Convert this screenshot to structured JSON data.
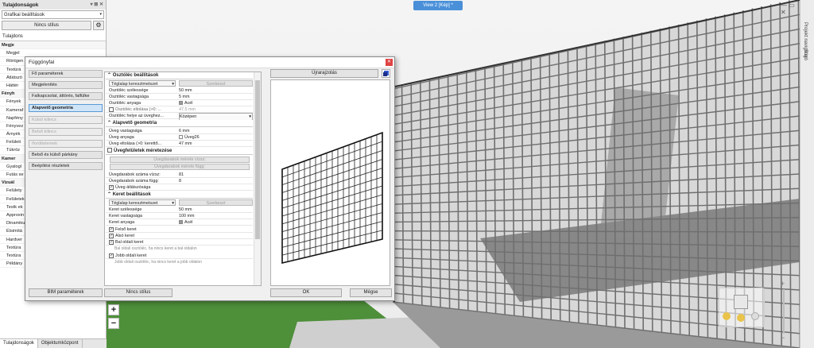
{
  "left_panel": {
    "title": "Tulajdonságok",
    "title_controls": "▾ ⊠ ✕",
    "category_select": "Grafikai beállítások",
    "style_button": "Nincs stílus",
    "tab_header": "Tulajdons",
    "rows": [
      {
        "t": "Megje",
        "sec": true
      },
      {
        "t": "Megjel",
        "sec": false
      },
      {
        "t": "Röntgen",
        "sec": false
      },
      {
        "t": "Textúrá",
        "sec": false
      },
      {
        "t": "Átlátszó",
        "sec": false
      },
      {
        "t": "Háttér",
        "sec": false
      },
      {
        "t": "Fényh",
        "sec": true
      },
      {
        "t": "Fények",
        "sec": false
      },
      {
        "t": "Kameraf",
        "sec": false
      },
      {
        "t": "Napfény",
        "sec": false
      },
      {
        "t": "Fényvez",
        "sec": false
      },
      {
        "t": "Árnyék",
        "sec": false
      },
      {
        "t": "Felületi",
        "sec": false
      },
      {
        "t": "Tükröz",
        "sec": false
      },
      {
        "t": "Kamer",
        "sec": true
      },
      {
        "t": "Gyalogl",
        "sec": false
      },
      {
        "t": "Futás se",
        "sec": false
      },
      {
        "t": "Vizuál",
        "sec": true
      },
      {
        "t": "Felülety",
        "sec": false
      },
      {
        "t": "Felületek",
        "sec": false
      },
      {
        "t": "Testk ek",
        "sec": false
      },
      {
        "t": "Approxin",
        "sec": false
      },
      {
        "t": "Dinamiku",
        "sec": false
      },
      {
        "t": "Élsimítá",
        "sec": false
      },
      {
        "t": "Hardver",
        "sec": false
      },
      {
        "t": "Textúra",
        "sec": false
      },
      {
        "t": "Textúra",
        "sec": false
      },
      {
        "t": "Példány",
        "sec": false
      }
    ],
    "bottom_tabs": [
      "Tulajdonságok",
      "Objektumközpont"
    ]
  },
  "viewport": {
    "tab_label": "View 2 [Kép] *",
    "window_controls": "— ▭ ✕",
    "zoom_in": "+",
    "zoom_out": "−"
  },
  "right_strip": {
    "labels": [
      "Projekt navigátor",
      "Súgó"
    ]
  },
  "dialog": {
    "title": "Függönyfal",
    "close": "✕",
    "nav": [
      {
        "label": "Fő paraméterek",
        "state": "normal"
      },
      {
        "label": "Megjelenítés",
        "state": "normal"
      },
      {
        "label": "Falkapcsolat, áttörés, falfülke",
        "state": "normal"
      },
      {
        "label": "Alapvető geometria",
        "state": "selected"
      },
      {
        "label": "Külső kilincs",
        "state": "disabled"
      },
      {
        "label": "Belső kilincs",
        "state": "disabled"
      },
      {
        "label": "Iforditelemek",
        "state": "disabled"
      },
      {
        "label": "Belső és külső párkány",
        "state": "normal"
      },
      {
        "label": "Beépítési részletek",
        "state": "normal"
      }
    ],
    "grid": {
      "sec1": "Osztóléc beállítások",
      "sec1_dd": "Téglalap keresztmetszet",
      "sec1_btn": "Szerkeszt",
      "osz_szel_k": "Osztóléc szélessége",
      "osz_szel_v": "50 mm",
      "osz_vast_k": "Osztóléc vastagsága",
      "osz_vast_v": "5 mm",
      "osz_any_k": "Osztóléc anyaga",
      "osz_any_v": "Acél",
      "osz_elt_k": "Osztóléc eltolása (>0: ...",
      "osz_elt_v": "47.5 mm",
      "osz_hely_k": "Osztóléc helye az üveghez...",
      "osz_hely_v": "Középen",
      "sec2": "Alapvető geometria",
      "uveg_vast_k": "Üveg vastagsága",
      "uveg_vast_v": "6 mm",
      "uveg_any_k": "Üveg anyaga",
      "uveg_any_v": "Üveg26",
      "uveg_elt_k": "Üveg eltolása (>0: kerettő...",
      "uveg_elt_v": "47 mm",
      "sec3": "Üvegfelületek méretezése",
      "btn_vizsz": "Üvegdarabok mérete vízsz:",
      "btn_fugg": "Üvegdarabok mérete függ:",
      "szam_vizsz_k": "Üvegdarabok száma vízsz:",
      "szam_vizsz_v": "81",
      "szam_fugg_k": "Üvegdarabok száma függ:",
      "szam_fugg_v": "8",
      "uveg_atl": "Üveg átlátszósága",
      "sec4": "Keret beállítások",
      "sec4_dd": "Téglalap keresztmetszet",
      "sec4_btn": "Szerkeszt",
      "ker_szel_k": "Keret szélessége",
      "ker_szel_v": "50 mm",
      "ker_vast_k": "Keret vastagsága",
      "ker_vast_v": "100 mm",
      "ker_any_k": "Keret anyaga",
      "ker_any_v": "Acél",
      "felso": "Felső keret",
      "also": "Alsó keret",
      "bal": "Bal oldali keret",
      "bal_note": "Bal oldali osztóléc, ha nincs keret a bal oldalon",
      "jobb": "Jobb oldali keret",
      "jobb_note": "Jobb oldali osztóléc, ha nincs keret a jobb oldalon"
    },
    "refresh_button": "Újrarajzolás",
    "bim_button": "BIM paraméterek",
    "style_button": "Nincs stílus",
    "ok_button": "OK",
    "cancel_button": "Mégse"
  },
  "colors": {
    "accent": "#4a90d9",
    "close_red": "#e04343",
    "grass": "#4e8f3a",
    "grid_line": "#6f6f6f"
  }
}
